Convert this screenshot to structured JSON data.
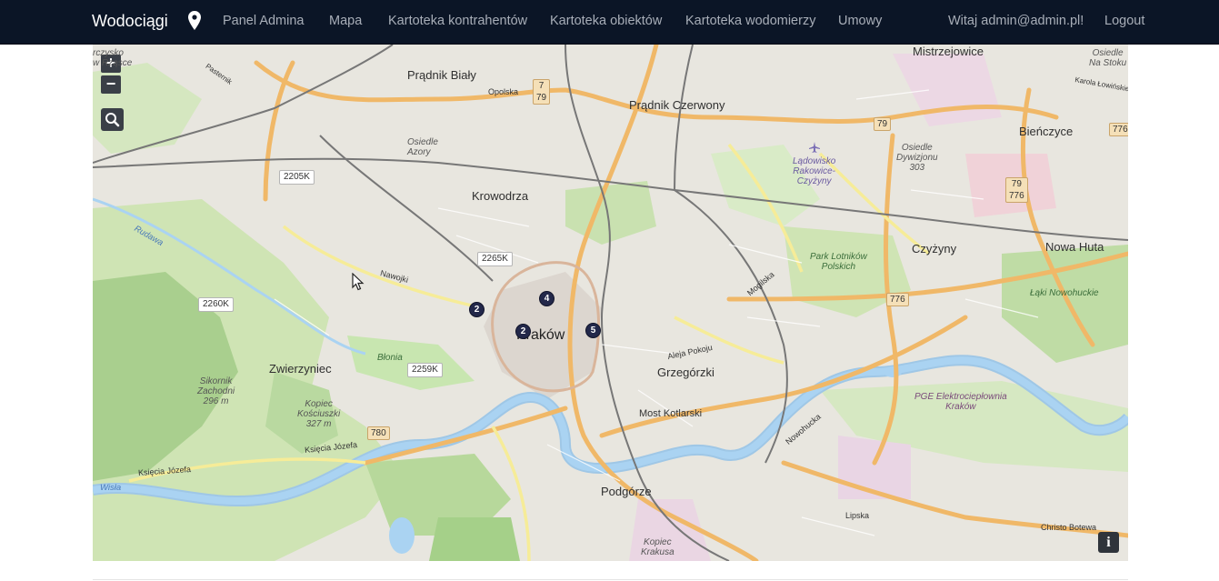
{
  "navbar": {
    "brand": "Wodociągi",
    "links": [
      "Panel Admina",
      "Mapa",
      "Kartoteka kontrahentów",
      "Kartoteka obiektów",
      "Kartoteka wodomierzy",
      "Umowy"
    ],
    "greeting": "Witaj admin@admin.pl!",
    "logout": "Logout"
  },
  "map": {
    "zoom_in": "+",
    "zoom_out": "−",
    "info": "i",
    "districts": {
      "pradnik_bialy": "Prądnik Biały",
      "pradnik_czerwony": "Prądnik Czerwony",
      "mistrzejowice": "Mistrzejowice",
      "bienczyce": "Bieńczyce",
      "krowodrza": "Krowodrza",
      "czyzyny": "Czyżyny",
      "nowa_huta": "Nowa Huta",
      "krakow": "Kraków",
      "zwierzyniec": "Zwierzyniec",
      "grzegorzki": "Grzegórzki",
      "most_kotlarski": "Most Kotlarski",
      "podgorze": "Podgórze"
    },
    "minor_labels": {
      "osiedle_azory": "Osiedle\nAzory",
      "osiedle_dywizjonu": "Osiedle\nDywizjonu\n303",
      "ladowisko": "Lądowisko\nRakowice-\nCzyżyny",
      "park_lotnikow": "Park Lotników\nPolskich",
      "laki": "Łąki Nowohuckie",
      "sikornik": "Sikornik\nZachodni\n296 m",
      "kopiec_kosciuszki": "Kopiec\nKościuszki\n327 m",
      "blonia": "Błonia",
      "pge": "PGE Elektrociepłownia\nKraków",
      "kopiec_krakusa": "Kopiec\nKrakusa",
      "osiedle_na_stoku": "Osiedle\nNa Stoku",
      "wolna": "rczysko\nw Rząsce"
    },
    "streets": {
      "opolska": "Opolska",
      "nawojki": "Nawojki",
      "mogilska": "Mogilska",
      "aleja_pokoju": "Aleja Pokoju",
      "ksiecia_jozefa_1": "Księcia Józefa",
      "ksiecia_jozefa_2": "Księcia Józefa",
      "nowohucka": "Nowohucka",
      "lipska": "Lipska",
      "christo_botewa": "Christo Botewa",
      "karola": "Karola Łowińskiego",
      "pasternik": "Pasternik",
      "rudawa": "Rudawa",
      "wisla": "Wisła"
    },
    "road_shields": {
      "r2205k": "2205K",
      "r2265k": "2265K",
      "r2260k": "2260K",
      "r2259k": "2259K",
      "r780": "780",
      "r79a": "7\n79",
      "r79b": "79",
      "r79_776": "79\n776",
      "r776a": "776",
      "r776b": "776"
    },
    "markers": [
      "2",
      "4",
      "2",
      "5"
    ]
  }
}
